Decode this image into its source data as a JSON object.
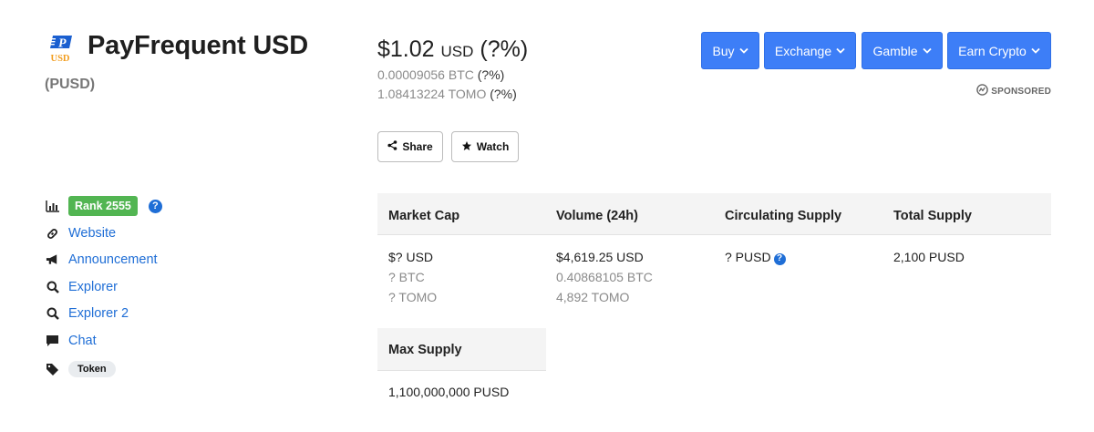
{
  "coin": {
    "name": "PayFrequent USD",
    "symbol": "(PUSD)",
    "logo_text": "USD"
  },
  "price": {
    "usd_value": "$1.02",
    "usd_unit": "USD",
    "usd_change": "(?%)",
    "btc_value": "0.00009056 BTC",
    "btc_change": "(?%)",
    "tomo_value": "1.08413224 TOMO",
    "tomo_change": "(?%)"
  },
  "actions": {
    "share_label": "Share",
    "watch_label": "Watch"
  },
  "top_buttons": {
    "buy": "Buy",
    "exchange": "Exchange",
    "gamble": "Gamble",
    "earn": "Earn Crypto"
  },
  "sponsored_label": "SPONSORED",
  "sidebar": {
    "rank_label": "Rank 2555",
    "help_glyph": "?",
    "links": {
      "website": "Website",
      "announcement": "Announcement",
      "explorer": "Explorer",
      "explorer2": "Explorer 2",
      "chat": "Chat"
    },
    "tag": "Token"
  },
  "stats": {
    "market_cap": {
      "label": "Market Cap",
      "usd": "$? USD",
      "btc": "? BTC",
      "tomo": "? TOMO"
    },
    "volume": {
      "label": "Volume (24h)",
      "usd": "$4,619.25 USD",
      "btc": "0.40868105 BTC",
      "tomo": "4,892 TOMO"
    },
    "circulating": {
      "label": "Circulating Supply",
      "value": "? PUSD"
    },
    "total": {
      "label": "Total Supply",
      "value": "2,100 PUSD"
    },
    "max": {
      "label": "Max Supply",
      "value": "1,100,000,000 PUSD"
    }
  },
  "colors": {
    "primary_button": "#3d7ef7",
    "link": "#1f6ed6",
    "rank_badge": "#52b552",
    "logo_blue": "#1a5fd0",
    "logo_orange": "#f29d1e"
  }
}
